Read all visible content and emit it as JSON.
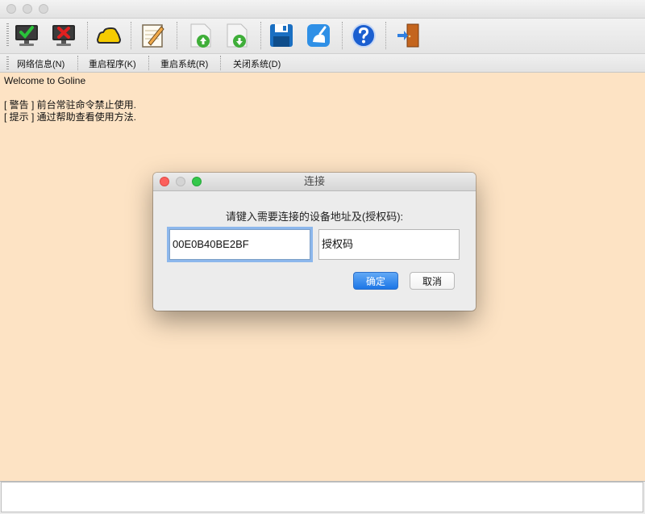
{
  "window": {
    "traffic_lights": [
      "close",
      "minimize",
      "zoom"
    ]
  },
  "toolbar": {
    "buttons": [
      {
        "icon": "connect-check-monitor-icon"
      },
      {
        "icon": "disconnect-x-monitor-icon"
      },
      {
        "icon": "yellow-cloud-icon"
      },
      {
        "icon": "edit-notepad-icon"
      },
      {
        "icon": "upload-page-icon"
      },
      {
        "icon": "download-page-icon"
      },
      {
        "icon": "save-floppy-icon"
      },
      {
        "icon": "clean-brush-icon"
      },
      {
        "icon": "help-question-icon"
      },
      {
        "icon": "exit-door-icon"
      }
    ]
  },
  "menu": {
    "items": [
      "网络信息(N)",
      "重启程序(K)",
      "重启系统(R)",
      "关闭系统(D)"
    ]
  },
  "console": {
    "lines": [
      "Welcome to Goline",
      "",
      "[ 警告 ] 前台常驻命令禁止使用.",
      "[ 提示 ] 通过帮助查看使用方法."
    ]
  },
  "dialog": {
    "title": "连接",
    "prompt": "请键入需要连接的设备地址及(授权码):",
    "address_value": "00E0B40BE2BF",
    "auth_value": "授权码",
    "ok_label": "确定",
    "cancel_label": "取消"
  },
  "colors": {
    "console_bg": "#fde3c4",
    "primary_button": "#1c76e6",
    "focus_ring": "#8cb7ec"
  }
}
